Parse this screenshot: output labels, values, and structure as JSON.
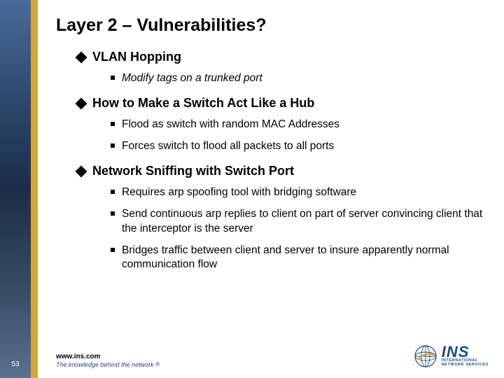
{
  "page_number": "53",
  "title": "Layer 2 – Vulnerabilities?",
  "bullets": [
    {
      "label": "VLAN Hopping",
      "items": [
        {
          "text": "Modify tags on a trunked port",
          "italic": true
        }
      ]
    },
    {
      "label": "How to Make a Switch Act Like a Hub",
      "items": [
        {
          "text": "Flood as switch with random MAC Addresses",
          "italic": false
        },
        {
          "text": "Forces switch to flood all packets to all ports",
          "italic": false
        }
      ]
    },
    {
      "label": "Network Sniffing with Switch Port",
      "items": [
        {
          "text": "Requires arp spoofing tool with bridging software",
          "italic": false
        },
        {
          "text": "Send continuous arp replies to client on part of server convincing client that the interceptor is the server",
          "italic": false
        },
        {
          "text": "Bridges traffic between client and server to insure apparently normal communication flow",
          "italic": false
        }
      ]
    }
  ],
  "footer": {
    "url": "www.ins.com",
    "tagline": "The knowledge behind the network ",
    "reg": "®"
  },
  "logo": {
    "main": "INS",
    "sub_top": "INTERNATIONAL",
    "sub_bottom": "NETWORK SERVICES"
  }
}
